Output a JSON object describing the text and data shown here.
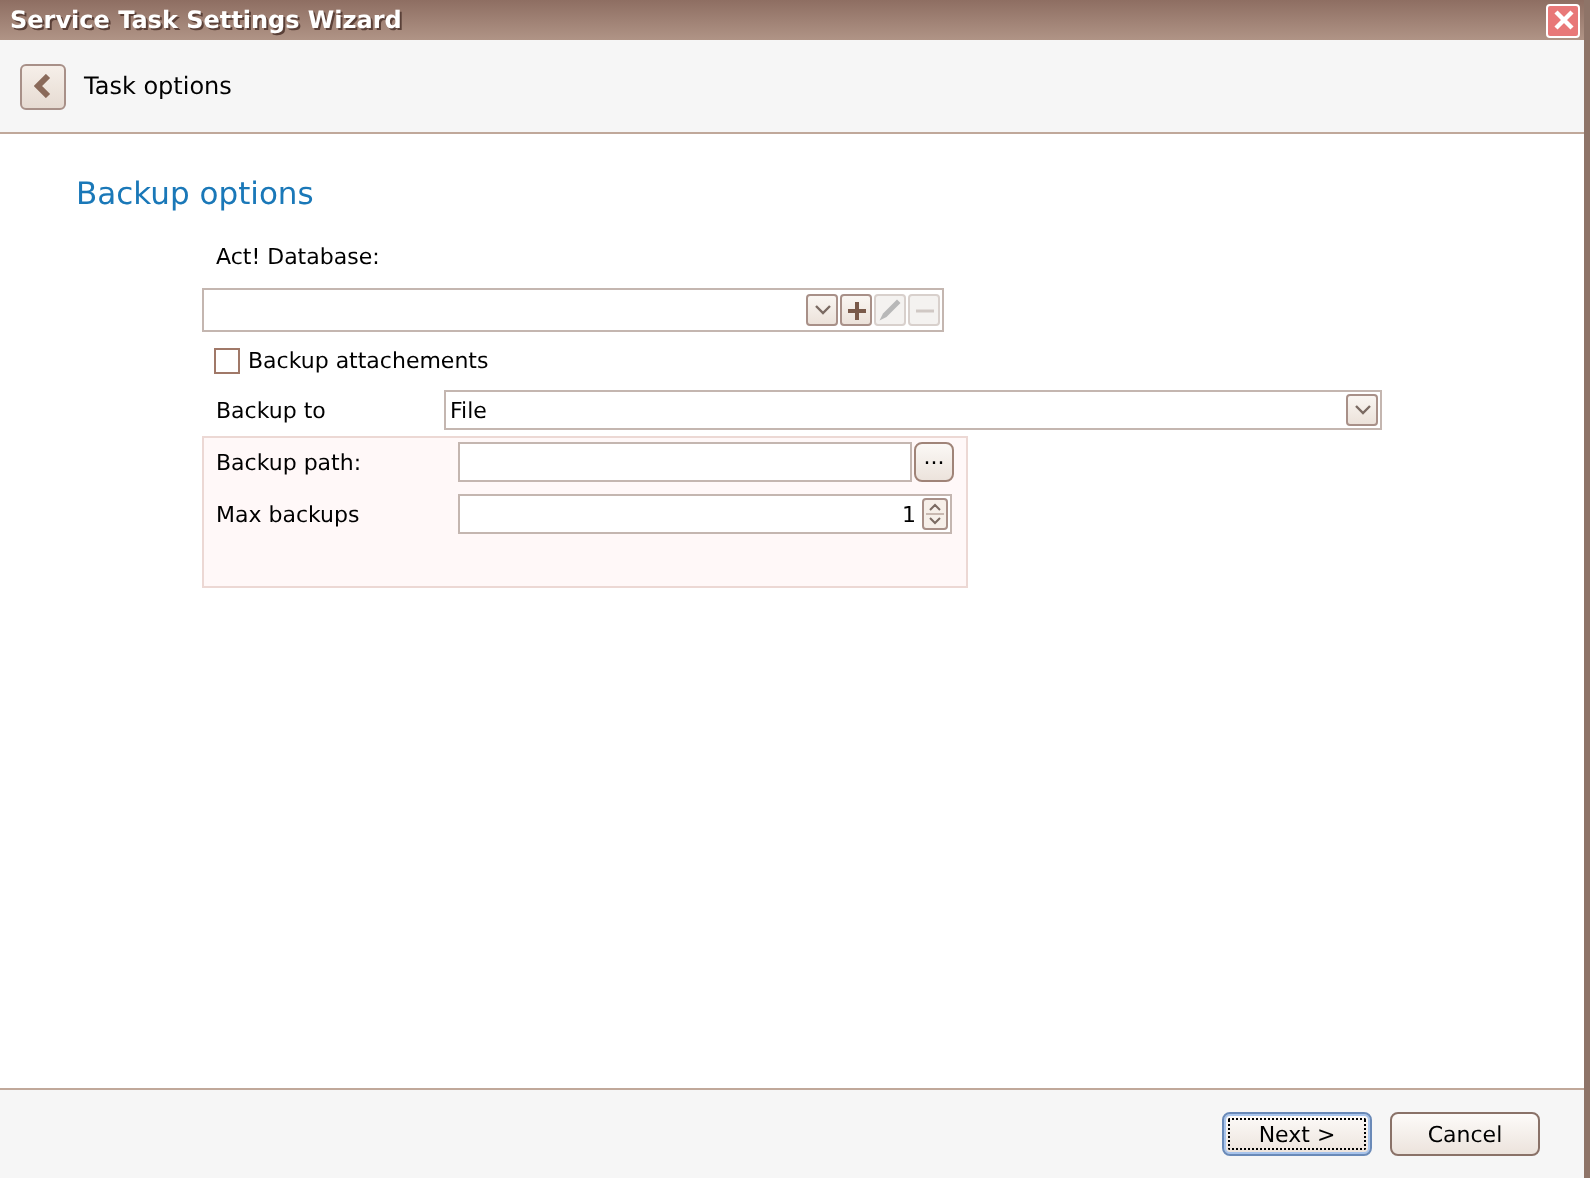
{
  "window": {
    "title": "Service Task Settings Wizard"
  },
  "header": {
    "title": "Task options"
  },
  "section": {
    "title": "Backup options"
  },
  "database": {
    "label": "Act! Database:",
    "buttons": [
      {
        "kind": "dropdown",
        "disabled": false
      },
      {
        "kind": "add",
        "disabled": false
      },
      {
        "kind": "edit",
        "disabled": true
      },
      {
        "kind": "remove",
        "disabled": true
      }
    ]
  },
  "attachments": {
    "label": "Backup attachements",
    "checked": false
  },
  "backup_to": {
    "label": "Backup to",
    "value": "File"
  },
  "backup_path": {
    "label": "Backup path:",
    "button": "..."
  },
  "max_backups": {
    "label": "Max backups",
    "value": "1"
  },
  "buttons": [
    {
      "label": "Next >",
      "default": true
    },
    {
      "label": "Cancel",
      "default": false
    }
  ]
}
